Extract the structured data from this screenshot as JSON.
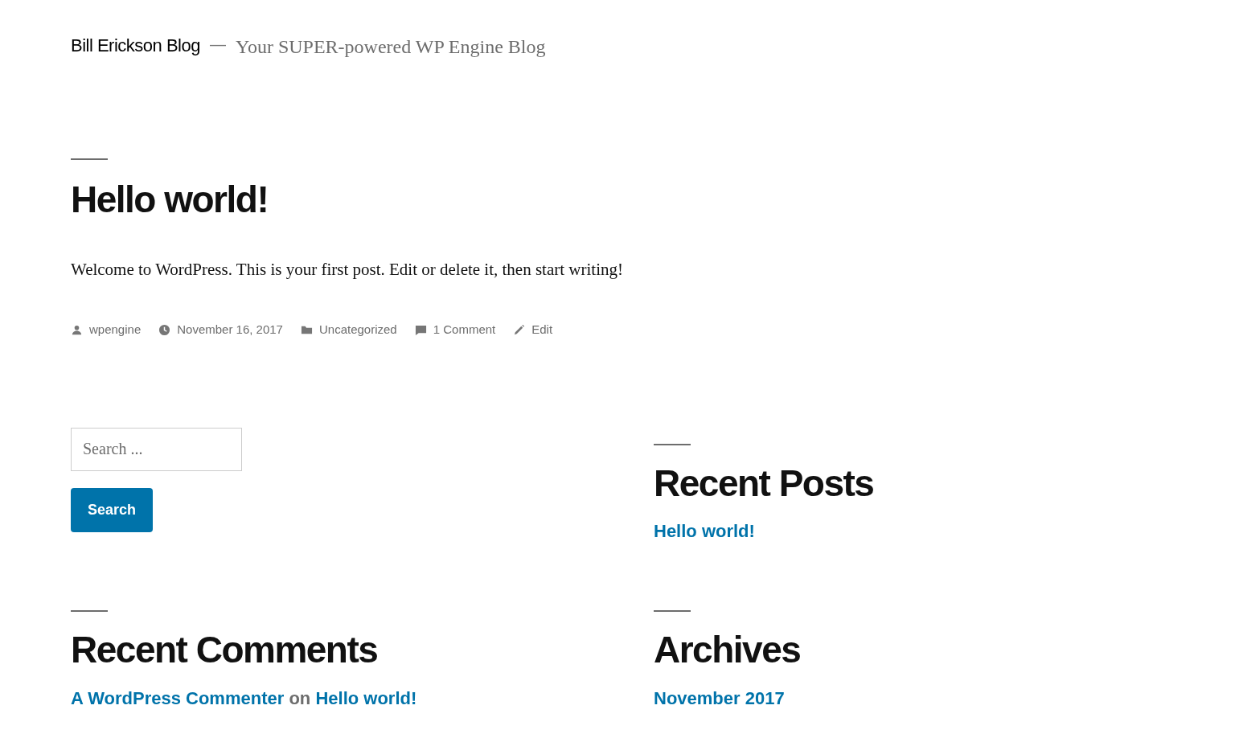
{
  "site": {
    "title": "Bill Erickson Blog",
    "separator": "—",
    "tagline": "Your SUPER-powered WP Engine Blog"
  },
  "post": {
    "title": "Hello world!",
    "body": "Welcome to WordPress. This is your first post. Edit or delete it, then start writing!",
    "meta": [
      {
        "kind": "author",
        "text": "wpengine"
      },
      {
        "kind": "date",
        "text": "November 16, 2017"
      },
      {
        "kind": "category",
        "text": "Uncategorized"
      },
      {
        "kind": "comments",
        "text": "1 Comment"
      },
      {
        "kind": "edit",
        "text": "Edit"
      }
    ]
  },
  "search": {
    "placeholder": "Search ...",
    "button": "Search"
  },
  "recent_posts": {
    "title": "Recent Posts",
    "items": [
      "Hello world!"
    ]
  },
  "recent_comments": {
    "title": "Recent Comments",
    "items": [
      {
        "author": "A WordPress Commenter",
        "connector": "on",
        "post": "Hello world!"
      }
    ]
  },
  "archives": {
    "title": "Archives",
    "items": [
      "November 2017"
    ]
  }
}
